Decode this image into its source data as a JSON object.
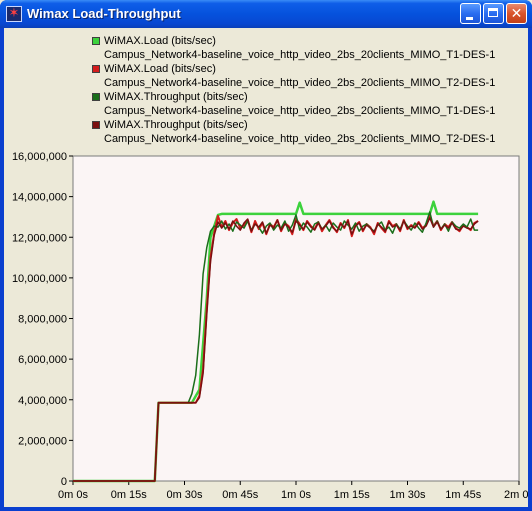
{
  "window": {
    "title": "Wimax Load-Throughput",
    "icon": "star-app-icon",
    "controls": [
      "minimize",
      "maximize",
      "close"
    ]
  },
  "legend": {
    "items": [
      {
        "name": "WiMAX.Load (bits/sec)",
        "scenario": "Campus_Network4-baseline_voice_http_video_2bs_20clients_MIMO_T1-DES-1",
        "color": "#3cd23c"
      },
      {
        "name": "WiMAX.Load (bits/sec)",
        "scenario": "Campus_Network4-baseline_voice_http_video_2bs_20clients_MIMO_T2-DES-1",
        "color": "#d41c1c"
      },
      {
        "name": "WiMAX.Throughput (bits/sec)",
        "scenario": "Campus_Network4-baseline_voice_http_video_2bs_20clients_MIMO_T1-DES-1",
        "color": "#1a6e1a"
      },
      {
        "name": "WiMAX.Throughput (bits/sec)",
        "scenario": "Campus_Network4-baseline_voice_http_video_2bs_20clients_MIMO_T2-DES-1",
        "color": "#7a1010"
      }
    ]
  },
  "chart_data": {
    "type": "line",
    "title": "",
    "xlabel": "",
    "ylabel": "",
    "xlim": [
      0,
      120
    ],
    "ylim": [
      0,
      16000000
    ],
    "grid": false,
    "legend_position": "top",
    "x_tick_values": [
      0,
      15,
      30,
      45,
      60,
      75,
      90,
      105,
      120
    ],
    "x_tick_labels": [
      "0m 0s",
      "0m 15s",
      "0m 30s",
      "0m 45s",
      "1m 0s",
      "1m 15s",
      "1m 30s",
      "1m 45s",
      "2m 0s"
    ],
    "y_tick_values": [
      0,
      2000000,
      4000000,
      6000000,
      8000000,
      10000000,
      12000000,
      14000000,
      16000000
    ],
    "y_tick_labels": [
      "0",
      "2,000,000",
      "4,000,000",
      "6,000,000",
      "8,000,000",
      "10,000,000",
      "12,000,000",
      "14,000,000",
      "16,000,000"
    ],
    "series": [
      {
        "name": "WiMAX.Load (bits/sec) Campus_Network4-baseline_voice_http_video_2bs_20clients_MIMO_T1-DES-1",
        "color": "#3cd23c",
        "x": [
          0,
          22,
          23,
          32,
          34,
          36,
          37,
          39,
          40,
          60,
          61,
          62,
          63,
          96,
          97,
          98,
          99,
          109
        ],
        "y": [
          0,
          0,
          3850000,
          3850000,
          4500000,
          9000000,
          12000000,
          13100000,
          13150000,
          13150000,
          13700000,
          13150000,
          13150000,
          13150000,
          13750000,
          13150000,
          13150000,
          13150000
        ]
      },
      {
        "name": "WiMAX.Load (bits/sec) Campus_Network4-baseline_voice_http_video_2bs_20clients_MIMO_T2-DES-1",
        "color": "#d41c1c",
        "x": [
          0,
          22,
          23,
          33,
          34,
          35,
          36,
          37,
          38,
          39,
          40,
          41,
          42,
          43,
          44,
          45,
          46,
          47,
          48,
          49,
          50,
          51,
          52,
          53,
          54,
          55,
          56,
          57,
          58,
          59,
          60,
          61,
          62,
          63,
          64,
          65,
          66,
          67,
          68,
          69,
          70,
          71,
          72,
          73,
          74,
          75,
          76,
          77,
          78,
          79,
          80,
          81,
          82,
          83,
          84,
          85,
          86,
          87,
          88,
          89,
          90,
          91,
          92,
          93,
          94,
          95,
          96,
          97,
          98,
          99,
          100,
          101,
          102,
          103,
          104,
          105,
          106,
          107,
          108,
          109
        ],
        "y": [
          0,
          0,
          3850000,
          3850000,
          4200000,
          5500000,
          8500000,
          11000000,
          12200000,
          13050000,
          12500000,
          12800000,
          12350000,
          12700000,
          12900000,
          12450000,
          12600000,
          12850000,
          12250000,
          12800000,
          12400000,
          12700000,
          12150000,
          12650000,
          12500000,
          12850000,
          12300000,
          12700000,
          12550000,
          12150000,
          12900000,
          12650000,
          12350000,
          12800000,
          12550000,
          12400000,
          12750000,
          12300000,
          12600000,
          12850000,
          12500000,
          12250000,
          12700000,
          12450000,
          12850000,
          12050000,
          12600000,
          12750000,
          12300000,
          12650000,
          12500000,
          12150000,
          12700000,
          12450000,
          12250000,
          12800000,
          12550000,
          12650000,
          12300000,
          12850000,
          12400000,
          12600000,
          12500000,
          12750000,
          12450000,
          12600000,
          13050000,
          12550000,
          12800000,
          12350000,
          12650000,
          12500000,
          12750000,
          12450000,
          12300000,
          12600000,
          12500000,
          12350000,
          12700000,
          12800000
        ]
      },
      {
        "name": "WiMAX.Throughput (bits/sec) Campus_Network4-baseline_voice_http_video_2bs_20clients_MIMO_T1-DES-1",
        "color": "#1a6e1a",
        "x": [
          0,
          22,
          23,
          31,
          32,
          33,
          34,
          35,
          36,
          37,
          38,
          39,
          40,
          41,
          42,
          43,
          44,
          45,
          46,
          47,
          48,
          49,
          50,
          51,
          52,
          53,
          54,
          55,
          56,
          57,
          58,
          59,
          60,
          61,
          62,
          63,
          64,
          65,
          66,
          67,
          68,
          69,
          70,
          71,
          72,
          73,
          74,
          75,
          76,
          77,
          78,
          79,
          80,
          81,
          82,
          83,
          84,
          85,
          86,
          87,
          88,
          89,
          90,
          91,
          92,
          93,
          94,
          95,
          96,
          97,
          98,
          99,
          100,
          101,
          102,
          103,
          104,
          105,
          106,
          107,
          108,
          109
        ],
        "y": [
          0,
          0,
          3850000,
          3850000,
          4300000,
          5200000,
          7200000,
          10200000,
          11500000,
          12300000,
          12550000,
          12500000,
          12800000,
          12400000,
          12650000,
          12300000,
          12750000,
          12600000,
          12450000,
          12800000,
          12350000,
          12650000,
          12500000,
          12200000,
          12550000,
          12700000,
          12350000,
          12600000,
          12450000,
          12800000,
          12300000,
          12600000,
          13100000,
          12350000,
          12700000,
          12500000,
          12250000,
          12650000,
          12750000,
          12400000,
          12600000,
          12300000,
          12700000,
          12500000,
          12350000,
          12800000,
          12600000,
          12400000,
          12700000,
          12300000,
          12550000,
          12650000,
          12450000,
          12300000,
          12600000,
          12750000,
          12350000,
          12500000,
          12200000,
          12650000,
          12400000,
          12800000,
          12550000,
          12350000,
          12700000,
          12450000,
          12250000,
          12700000,
          13250000,
          12500000,
          12800000,
          12400000,
          12650000,
          12300000,
          12750000,
          12550000,
          12450000,
          12650000,
          12500000,
          12900000,
          12350000,
          12350000
        ]
      },
      {
        "name": "WiMAX.Throughput (bits/sec) Campus_Network4-baseline_voice_http_video_2bs_20clients_MIMO_T2-DES-1",
        "color": "#7a1010",
        "x": [
          0,
          22,
          23,
          33,
          34,
          35,
          36,
          37,
          38,
          39,
          40,
          41,
          42,
          43,
          44,
          45,
          46,
          47,
          48,
          49,
          50,
          51,
          52,
          53,
          54,
          55,
          56,
          57,
          58,
          59,
          60,
          61,
          62,
          63,
          64,
          65,
          66,
          67,
          68,
          69,
          70,
          71,
          72,
          73,
          74,
          75,
          76,
          77,
          78,
          79,
          80,
          81,
          82,
          83,
          84,
          85,
          86,
          87,
          88,
          89,
          90,
          91,
          92,
          93,
          94,
          95,
          96,
          97,
          98,
          99,
          100,
          101,
          102,
          103,
          104,
          105,
          106,
          107,
          108,
          109
        ],
        "y": [
          0,
          0,
          3850000,
          3850000,
          4100000,
          5300000,
          8200000,
          10800000,
          12100000,
          12750000,
          12450000,
          12700000,
          12400000,
          12800000,
          12550000,
          12350000,
          12700000,
          12900000,
          12300000,
          12650000,
          12500000,
          12750000,
          12200000,
          12600000,
          12450000,
          12850000,
          12350000,
          12650000,
          12500000,
          12250000,
          12800000,
          12600000,
          12400000,
          12750000,
          12500000,
          12350000,
          12700000,
          12400000,
          12550000,
          12800000,
          12450000,
          12300000,
          12650000,
          12500000,
          12800000,
          12150000,
          12550000,
          12700000,
          12350000,
          12600000,
          12450000,
          12250000,
          12650000,
          12500000,
          12300000,
          12750000,
          12500000,
          12600000,
          12350000,
          12800000,
          12450000,
          12550000,
          12450000,
          12700000,
          12400000,
          12550000,
          12950000,
          12500000,
          12750000,
          12400000,
          12600000,
          12450000,
          12700000,
          12400000,
          12350000,
          12550000,
          12450000,
          12400000,
          12650000,
          12800000
        ]
      }
    ]
  }
}
